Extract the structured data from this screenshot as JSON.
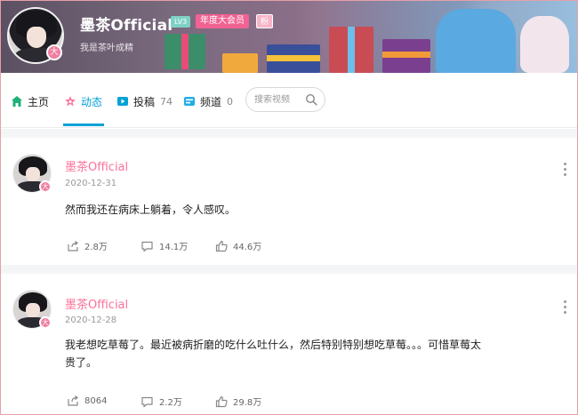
{
  "profile": {
    "name": "墨茶Official",
    "level": "LV3",
    "vip": "年度大会员",
    "fan_badge": "粉",
    "signature": "我是茶叶成精",
    "avatar_badge": "大"
  },
  "nav": {
    "home": {
      "label": "主页"
    },
    "dynamic": {
      "label": "动态"
    },
    "videos": {
      "label": "投稿",
      "count": "74"
    },
    "channels": {
      "label": "频道",
      "count": "0"
    },
    "search_placeholder": "搜索视频"
  },
  "posts": [
    {
      "author": "墨茶Official",
      "date": "2020-12-31",
      "text": "然而我还在病床上躺着，令人感叹。",
      "shares": "2.8万",
      "comments": "14.1万",
      "likes": "44.6万"
    },
    {
      "author": "墨茶Official",
      "date": "2020-12-28",
      "text": "我老想吃草莓了。最近被病折磨的吃什么吐什么，然后特别特别想吃草莓。。。可惜草莓太贵了。",
      "shares": "8064",
      "comments": "2.2万",
      "likes": "29.8万"
    }
  ],
  "colors": {
    "accent": "#00a1d6",
    "pink": "#fb7299",
    "vip": "#f06292",
    "background_gap": "#f4f5f7"
  }
}
